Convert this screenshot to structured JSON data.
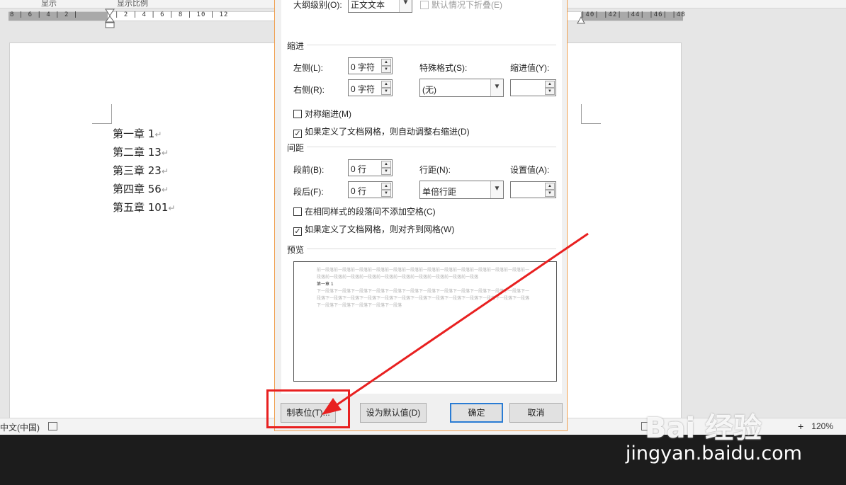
{
  "topband": {
    "left_text": "显示",
    "right_text": "显示比例"
  },
  "ruler": {
    "left_ticks": "8 | 6 | 4 | 2 |",
    "mid_ticks": "| 2 | 4 | 6 | 8 | 10 | 12",
    "right_ticks": "|40| |42| |44| |46| |48"
  },
  "document": {
    "lines": [
      "第一章 1",
      "第二章 13",
      "第三章 23",
      "第四章 56",
      "第五章 101"
    ],
    "return_mark": "↵"
  },
  "statusbar": {
    "language": "中文(中国)",
    "zoom": "120%",
    "zoom_plus": "+"
  },
  "dialog": {
    "outline_level_label": "大纲级别(O):",
    "outline_level_value": "正文文本",
    "collapse_label": "默认情况下折叠(E)",
    "indent_group": "缩进",
    "left_label": "左侧(L):",
    "left_value": "0 字符",
    "right_label": "右侧(R):",
    "right_value": "0 字符",
    "special_label": "特殊格式(S):",
    "special_value": "(无)",
    "indent_value_label": "缩进值(Y):",
    "mirror_indent": "对称缩进(M)",
    "auto_adjust_right": "如果定义了文档网格，则自动调整右缩进(D)",
    "spacing_group": "间距",
    "before_label": "段前(B):",
    "before_value": "0 行",
    "after_label": "段后(F):",
    "after_value": "0 行",
    "line_spacing_label": "行距(N):",
    "line_spacing_value": "单倍行距",
    "setting_value_label": "设置值(A):",
    "no_space_same_style": "在相同样式的段落间不添加空格(C)",
    "snap_to_grid": "如果定义了文档网格，则对齐到网格(W)",
    "preview_group": "预览",
    "preview_prev": "前一段落前一段落前一段落前一段落前一段落前一段落前一段落前一段落前一段落前一段落前一段落前一段落前一段落前一段落前一段落前一段落前一段落前一段落前一段落前一段落前一段落前一段落",
    "preview_current": "第一章 1",
    "preview_next": "下一段落下一段落下一段落下一段落下一段落下一段落下一段落下一段落下一段落下一段落下一段落下一段落下一段落下一段落下一段落下一段落下一段落下一段落下一段落下一段落下一段落下一段落下一段落下一段落下一段落下一段落下一段落下一段落下一段落下一段落",
    "tabs_button": "制表位(T)...",
    "set_default_button": "设为默认值(D)",
    "ok_button": "确定",
    "cancel_button": "取消"
  },
  "watermark": {
    "logo": "Bai 经验",
    "url": "jingyan.baidu.com"
  },
  "colors": {
    "annotation": "#e82020",
    "dialog_border": "#f0a050",
    "default_button_border": "#2a7cd4"
  }
}
